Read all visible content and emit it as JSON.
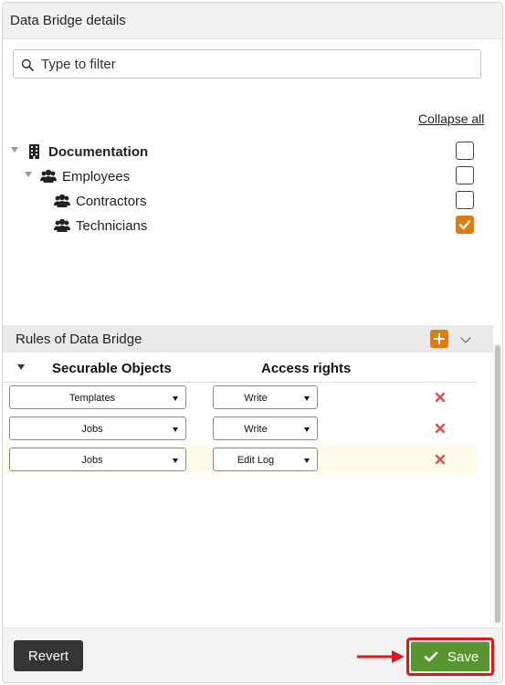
{
  "panel": {
    "title": "Data Bridge details"
  },
  "filter": {
    "placeholder": "Type to filter"
  },
  "tree": {
    "collapse_all": "Collapse all",
    "nodes": [
      {
        "label": "Documentation",
        "icon": "building-icon",
        "checked": false
      },
      {
        "label": "Employees",
        "icon": "users-icon",
        "checked": false
      },
      {
        "label": "Contractors",
        "icon": "users-icon",
        "checked": false
      },
      {
        "label": "Technicians",
        "icon": "users-icon",
        "checked": true
      }
    ]
  },
  "rules": {
    "title": "Rules of Data Bridge",
    "columns": {
      "objects": "Securable Objects",
      "rights": "Access rights"
    },
    "rows": [
      {
        "object": "Templates",
        "right": "Write"
      },
      {
        "object": "Jobs",
        "right": "Write"
      },
      {
        "object": "Jobs",
        "right": "Edit Log"
      }
    ]
  },
  "footer": {
    "revert_label": "Revert",
    "save_label": "Save"
  },
  "colors": {
    "accent": "#e07b14",
    "save": "#58962f",
    "highlight": "#e0161e",
    "delete": "#d9534f"
  }
}
